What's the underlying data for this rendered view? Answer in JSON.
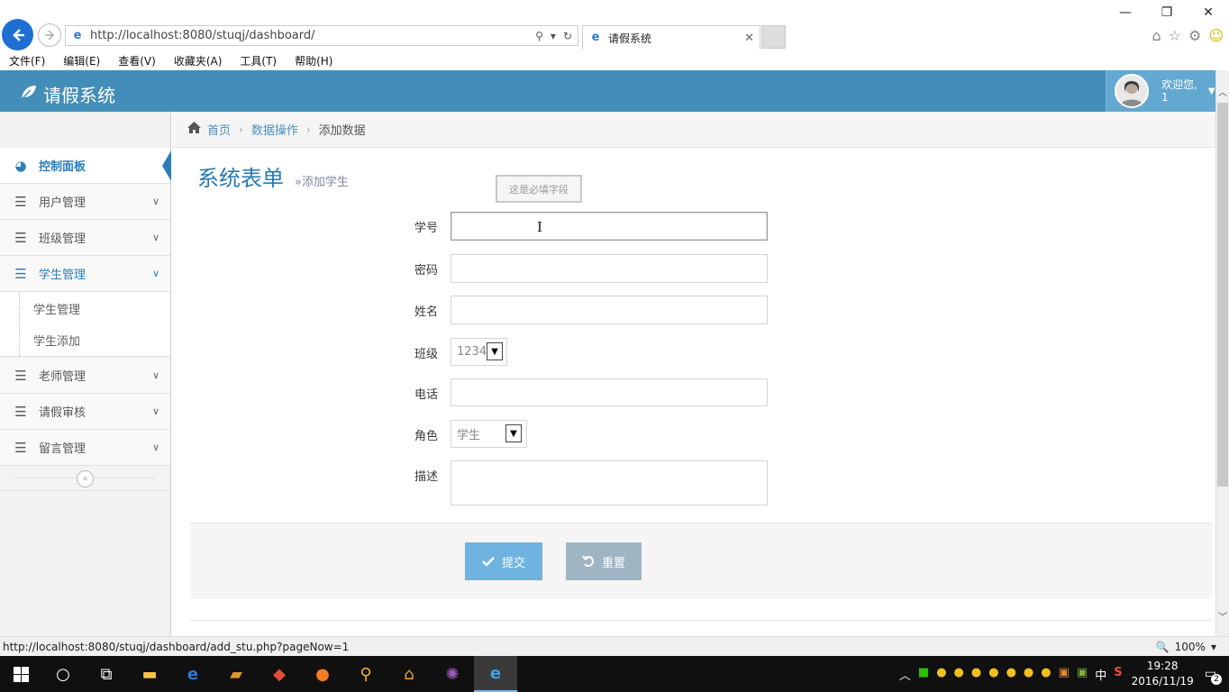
{
  "browser": {
    "url": "http://localhost:8080/stuqj/dashboard/",
    "tab_title": "请假系统",
    "menu": [
      "文件(F)",
      "编辑(E)",
      "查看(V)",
      "收藏夹(A)",
      "工具(T)",
      "帮助(H)"
    ],
    "status_url": "http://localhost:8080/stuqj/dashboard/add_stu.php?pageNow=1",
    "zoom": "100%"
  },
  "app": {
    "title": "请假系统",
    "user_greeting": "欢迎您,",
    "user_name": "1"
  },
  "sidebar": {
    "items": [
      {
        "label": "控制面板",
        "icon": "dashboard-icon"
      },
      {
        "label": "用户管理",
        "icon": "list-icon"
      },
      {
        "label": "班级管理",
        "icon": "list-icon"
      },
      {
        "label": "学生管理",
        "icon": "list-icon"
      },
      {
        "label": "老师管理",
        "icon": "list-icon"
      },
      {
        "label": "请假审核",
        "icon": "list-icon"
      },
      {
        "label": "留言管理",
        "icon": "list-icon"
      }
    ],
    "sub_items": [
      "学生管理",
      "学生添加"
    ]
  },
  "breadcrumb": {
    "home": "首页",
    "section": "数据操作",
    "current": "添加数据"
  },
  "page": {
    "title": "系统表单",
    "subtitle": "添加学生"
  },
  "tooltip": "这是必填字段",
  "form": {
    "labels": {
      "student_id": "学号",
      "password": "密码",
      "name": "姓名",
      "class": "班级",
      "phone": "电话",
      "role": "角色",
      "description": "描述"
    },
    "class_value": "1234",
    "role_value": "学生",
    "submit_label": "提交",
    "reset_label": "重置"
  },
  "taskbar": {
    "time": "19:28",
    "date": "2016/11/19",
    "ime": "中",
    "notifications": "2"
  },
  "colors": {
    "header": "#438eb9",
    "accent": "#2b7dbc",
    "submit": "#6fb3e0",
    "reset": "#a0b5c4"
  }
}
